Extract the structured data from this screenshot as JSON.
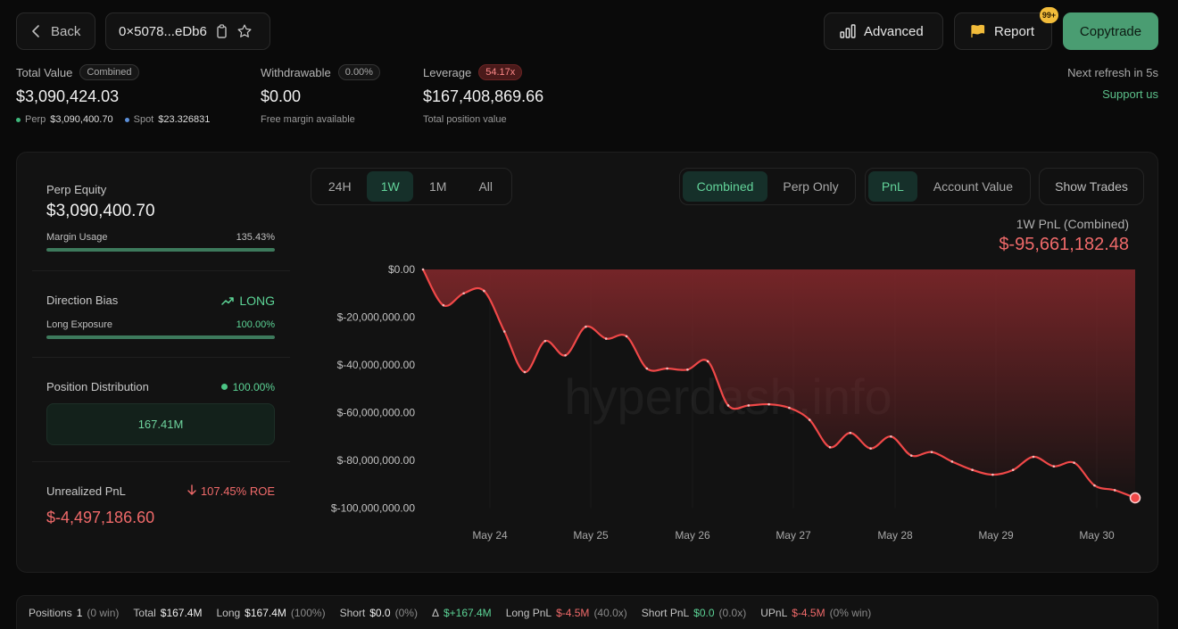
{
  "topbar": {
    "back_label": "Back",
    "address": "0×5078...eDb6",
    "advanced_label": "Advanced",
    "report_label": "Report",
    "report_badge": "99+",
    "copytrade_label": "Copytrade"
  },
  "stats": {
    "total_value": {
      "label": "Total Value",
      "pill": "Combined",
      "value": "$3,090,424.03",
      "perp_label": "Perp",
      "perp_value": "$3,090,400.70",
      "spot_label": "Spot",
      "spot_value": "$23.326831"
    },
    "withdrawable": {
      "label": "Withdrawable",
      "pill": "0.00%",
      "value": "$0.00",
      "sub": "Free margin available"
    },
    "leverage": {
      "label": "Leverage",
      "pill": "54.17x",
      "value": "$167,408,869.66",
      "sub": "Total position value"
    }
  },
  "refresh_text": "Next refresh in 5s",
  "support_text": "Support us",
  "side": {
    "perp_equity": {
      "label": "Perp Equity",
      "value": "$3,090,400.70",
      "margin_label": "Margin Usage",
      "margin_value": "135.43%",
      "margin_fill": 1.0
    },
    "direction": {
      "label": "Direction Bias",
      "bias": "LONG",
      "exposure_label": "Long Exposure",
      "exposure_value": "100.00%",
      "exposure_fill": 1.0
    },
    "distribution": {
      "label": "Position Distribution",
      "percent": "100.00%",
      "box_value": "167.41M"
    },
    "unrealized": {
      "label": "Unrealized PnL",
      "roe": "107.45% ROE",
      "value": "$-4,497,186.60"
    }
  },
  "controls": {
    "timeframes": [
      "24H",
      "1W",
      "1M",
      "All"
    ],
    "timeframe_active": 1,
    "scope": [
      "Combined",
      "Perp Only"
    ],
    "scope_active": 0,
    "metric": [
      "PnL",
      "Account Value"
    ],
    "metric_active": 0,
    "show_trades": "Show Trades"
  },
  "chart_header": {
    "title": "1W PnL (Combined)",
    "value": "$-95,661,182.48"
  },
  "chart_data": {
    "type": "area",
    "title": "1W PnL (Combined)",
    "xlabel": "",
    "ylabel": "",
    "x_ticks": [
      "May 24",
      "May 25",
      "May 26",
      "May 27",
      "May 28",
      "May 29",
      "May 30"
    ],
    "y_ticks": [
      "$0.00",
      "$-20,000,000.00",
      "$-40,000,000.00",
      "$-60,000,000.00",
      "$-80,000,000.00",
      "$-100,000,000.00"
    ],
    "ylim": [
      -100000000,
      0
    ],
    "watermark": "hyperdash.info",
    "series": [
      {
        "values": [
          [
            "May 23",
            0
          ],
          [
            "May 23",
            -15000000
          ],
          [
            "May 23",
            -10000000
          ],
          [
            "May 23",
            -9000000
          ],
          [
            "May 23",
            -26000000
          ],
          [
            "May 24",
            -43000000
          ],
          [
            "May 24",
            -30000000
          ],
          [
            "May 24",
            -36000000
          ],
          [
            "May 24",
            -24000000
          ],
          [
            "May 24",
            -29000000
          ],
          [
            "May 24",
            -28000000
          ],
          [
            "May 25",
            -41500000
          ],
          [
            "May 25",
            -41500000
          ],
          [
            "May 25",
            -42000000
          ],
          [
            "May 25",
            -38500000
          ],
          [
            "May 26",
            -57000000
          ],
          [
            "May 26",
            -57000000
          ],
          [
            "May 26",
            -56500000
          ],
          [
            "May 26",
            -58000000
          ],
          [
            "May 26",
            -63000000
          ],
          [
            "May 27",
            -74500000
          ],
          [
            "May 27",
            -68500000
          ],
          [
            "May 27",
            -75000000
          ],
          [
            "May 27",
            -70000000
          ],
          [
            "May 28",
            -78000000
          ],
          [
            "May 28",
            -76500000
          ],
          [
            "May 28",
            -80500000
          ],
          [
            "May 28",
            -84000000
          ],
          [
            "May 29",
            -86000000
          ],
          [
            "May 29",
            -84000000
          ],
          [
            "May 29",
            -78500000
          ],
          [
            "May 29",
            -82500000
          ],
          [
            "May 29",
            -81000000
          ],
          [
            "May 30",
            -90500000
          ],
          [
            "May 30",
            -92500000
          ],
          [
            "May 30",
            -95700000
          ]
        ]
      }
    ]
  },
  "bottombar": {
    "positions_label": "Positions",
    "positions_value": "1",
    "positions_win": "(0 win)",
    "total_label": "Total",
    "total_value": "$167.4M",
    "long_label": "Long",
    "long_value": "$167.4M",
    "long_pct": "(100%)",
    "short_label": "Short",
    "short_value": "$0.0",
    "short_pct": "(0%)",
    "delta_label": "Δ",
    "delta_value": "$+167.4M",
    "longpnl_label": "Long PnL",
    "longpnl_value": "$-4.5M",
    "longpnl_x": "(40.0x)",
    "shortpnl_label": "Short PnL",
    "shortpnl_value": "$0.0",
    "shortpnl_x": "(0.0x)",
    "upnl_label": "UPnL",
    "upnl_value": "$-4.5M",
    "upnl_win": "(0% win)"
  }
}
